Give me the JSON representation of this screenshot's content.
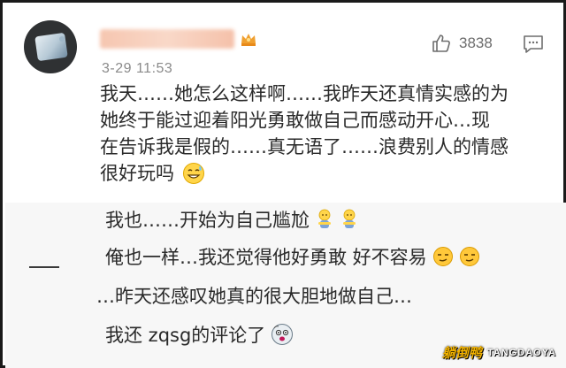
{
  "comment": {
    "timestamp": "3-29 11:53",
    "like_count": "3838",
    "text_lines": [
      "我天……她怎么这样啊……我昨天还真情实感的为",
      "她终于能过迎着阳光勇敢做自己而感动开心…现",
      "在告诉我是假的……真无语了……浪费别人的情感",
      "很好玩吗"
    ],
    "icons": {
      "like": "thumbs-up-icon",
      "reply": "comment-icon",
      "vip": "crown-badge-icon"
    }
  },
  "replies": [
    {
      "text": "我也……开始为自己尴尬",
      "emoji": "embarrassed-emoji"
    },
    {
      "text": "俺也一样…我还觉得他好勇敢 好不容易",
      "emoji": "sly-smile-emoji"
    },
    {
      "text": "…昨天还感叹她真的很大胆地做自己…",
      "emoji": ""
    },
    {
      "text": "我还 zqsg的评论了",
      "emoji": "shocked-emoji"
    }
  ],
  "watermark": {
    "cn": "躺倒鸭",
    "en": "TANGDAOYA"
  },
  "colors": {
    "accent_badge": "#f0a030",
    "muted_text": "#8a8a8a",
    "reply_bg": "#f7f7f7",
    "watermark_yellow": "#f3b300"
  }
}
